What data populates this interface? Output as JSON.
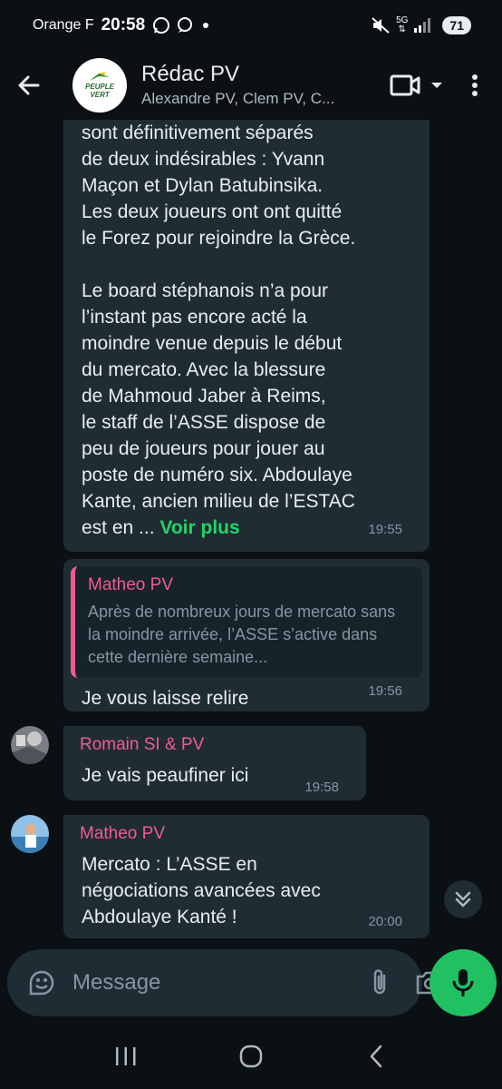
{
  "status_bar": {
    "carrier": "Orange F",
    "time": "20:58",
    "network": "5G",
    "battery": "71",
    "icons": [
      "whatsapp-icon",
      "message-icon",
      "dot-icon",
      "mute-icon",
      "network-icon",
      "signal-icon",
      "battery-icon"
    ]
  },
  "header": {
    "title": "Rédac PV",
    "subtitle": "Alexandre PV, Clem PV, C...",
    "avatar_logo_line1": "PEUPLE",
    "avatar_logo_line2": "VERT",
    "icons": [
      "back-arrow-icon",
      "video-call-icon",
      "dropdown-caret-icon",
      "more-options-icon"
    ]
  },
  "messages": [
    {
      "type": "incoming",
      "text": "sont définitivement séparés\nde deux indésirables : Yvann\nMaçon et Dylan Batubinsika.\nLes deux joueurs ont ont quitté\nle Forez pour rejoindre la Grèce.\n\nLe board stéphanois n’a pour\nl’instant pas encore acté la\nmoindre venue depuis le début\ndu mercato. Avec la blessure\nde Mahmoud Jaber à Reims,\nle staff de l’ASSE dispose de\npeu de joueurs pour jouer au\nposte de numéro six. Abdoulaye\nKante, ancien milieu de l’ESTAC\nest en ...",
      "see_more": "Voir plus",
      "time": "19:55"
    },
    {
      "type": "incoming",
      "quote_author": "Matheo PV",
      "quote_text": "Après de nombreux jours de mercato sans la moindre arrivée, l’ASSE s’active dans cette dernière semaine...",
      "text": "Je vous laisse relire",
      "time": "19:56"
    },
    {
      "type": "incoming",
      "sender": "Romain SI & PV",
      "sender_color": "#f15c8d",
      "text": "Je vais peaufiner ici",
      "time": "19:58"
    },
    {
      "type": "incoming",
      "sender": "Matheo PV",
      "sender_color": "#f15c8d",
      "text": "Mercato : L’ASSE en\nnégociations avancées avec\nAbdoulaye Kanté !",
      "time": "20:00"
    }
  ],
  "input": {
    "placeholder": "Message",
    "icons": [
      "sticker-icon",
      "attach-icon",
      "camera-icon",
      "mic-icon"
    ]
  },
  "nav": {
    "icons": [
      "recent-apps-icon",
      "home-icon",
      "back-icon"
    ]
  },
  "colors": {
    "accent": "#25d366",
    "bubble": "#1f2c34",
    "background": "#0b1014",
    "sender_name": "#f15c8d",
    "mic_button": "#21c063"
  }
}
